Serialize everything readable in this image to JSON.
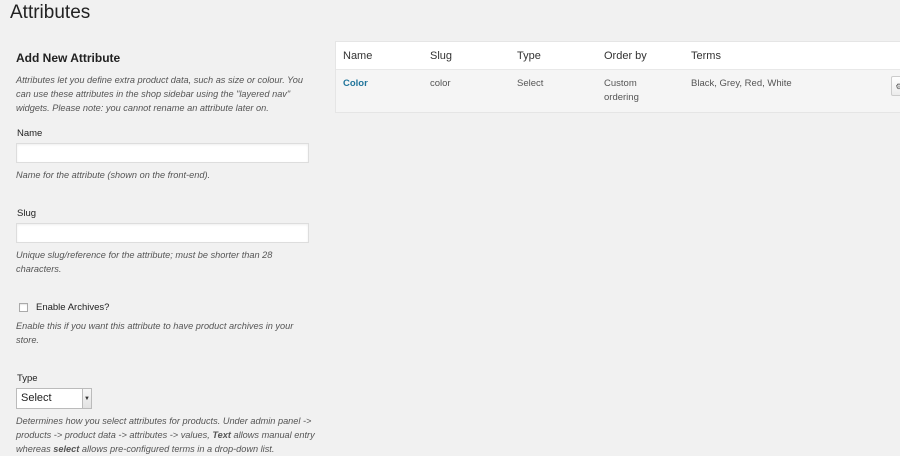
{
  "page": {
    "title": "Attributes"
  },
  "form": {
    "heading": "Add New Attribute",
    "intro": "Attributes let you define extra product data, such as size or colour. You can use these attributes in the shop sidebar using the \"layered nav\" widgets. Please note: you cannot rename an attribute later on.",
    "name": {
      "label": "Name",
      "value": "",
      "help": "Name for the attribute (shown on the front-end)."
    },
    "slug": {
      "label": "Slug",
      "value": "",
      "help": "Unique slug/reference for the attribute; must be shorter than 28 characters."
    },
    "archives": {
      "label": "Enable Archives?",
      "checked": false,
      "help": "Enable this if you want this attribute to have product archives in your store."
    },
    "type": {
      "label": "Type",
      "selected": "Select",
      "help_part1": "Determines how you select attributes for products. Under admin panel -> products -> product data -> attributes -> values, ",
      "help_text_word": "Text",
      "help_part2": " allows manual entry whereas ",
      "help_select_word": "select",
      "help_part3": " allows pre-configured terms in a drop-down list."
    }
  },
  "table": {
    "headers": {
      "name": "Name",
      "slug": "Slug",
      "type": "Type",
      "order_by": "Order by",
      "terms": "Terms"
    },
    "rows": [
      {
        "name": "Color",
        "slug": "color",
        "type": "Select",
        "order_by": "Custom ordering",
        "terms": "Black, Grey, Red, White"
      }
    ]
  },
  "icons": {
    "configure": "gear-icon",
    "dropdown": "chevron-down-icon"
  }
}
